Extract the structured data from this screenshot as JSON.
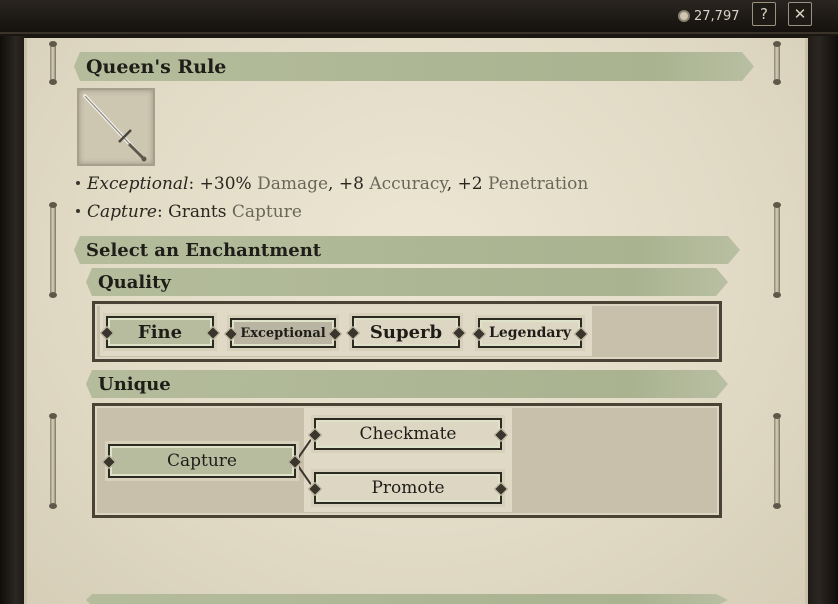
{
  "hud": {
    "gold_amount": "27,797",
    "help_label": "?",
    "close_label": "✕"
  },
  "item": {
    "name": "Queen's Rule",
    "icon": "sword-icon",
    "properties": [
      {
        "name": "Exceptional",
        "sep": ": ",
        "text_parts": [
          "+30% ",
          "Damage",
          ", +8 ",
          "Accuracy",
          ", +2 ",
          "Penetration"
        ]
      },
      {
        "name": "Capture",
        "sep": ": ",
        "text_parts": [
          "Grants ",
          "Capture"
        ]
      }
    ]
  },
  "enchant": {
    "header": "Select an Enchantment",
    "quality": {
      "header": "Quality",
      "slots": [
        "Fine",
        "Exceptional",
        "Superb",
        "Legendary"
      ]
    },
    "unique": {
      "header": "Unique",
      "root": "Capture",
      "branches": [
        "Checkmate",
        "Promote"
      ]
    }
  },
  "colors": {
    "band": "#aab393",
    "parchment": "#e6dfcb",
    "frame": "#1a1612"
  }
}
